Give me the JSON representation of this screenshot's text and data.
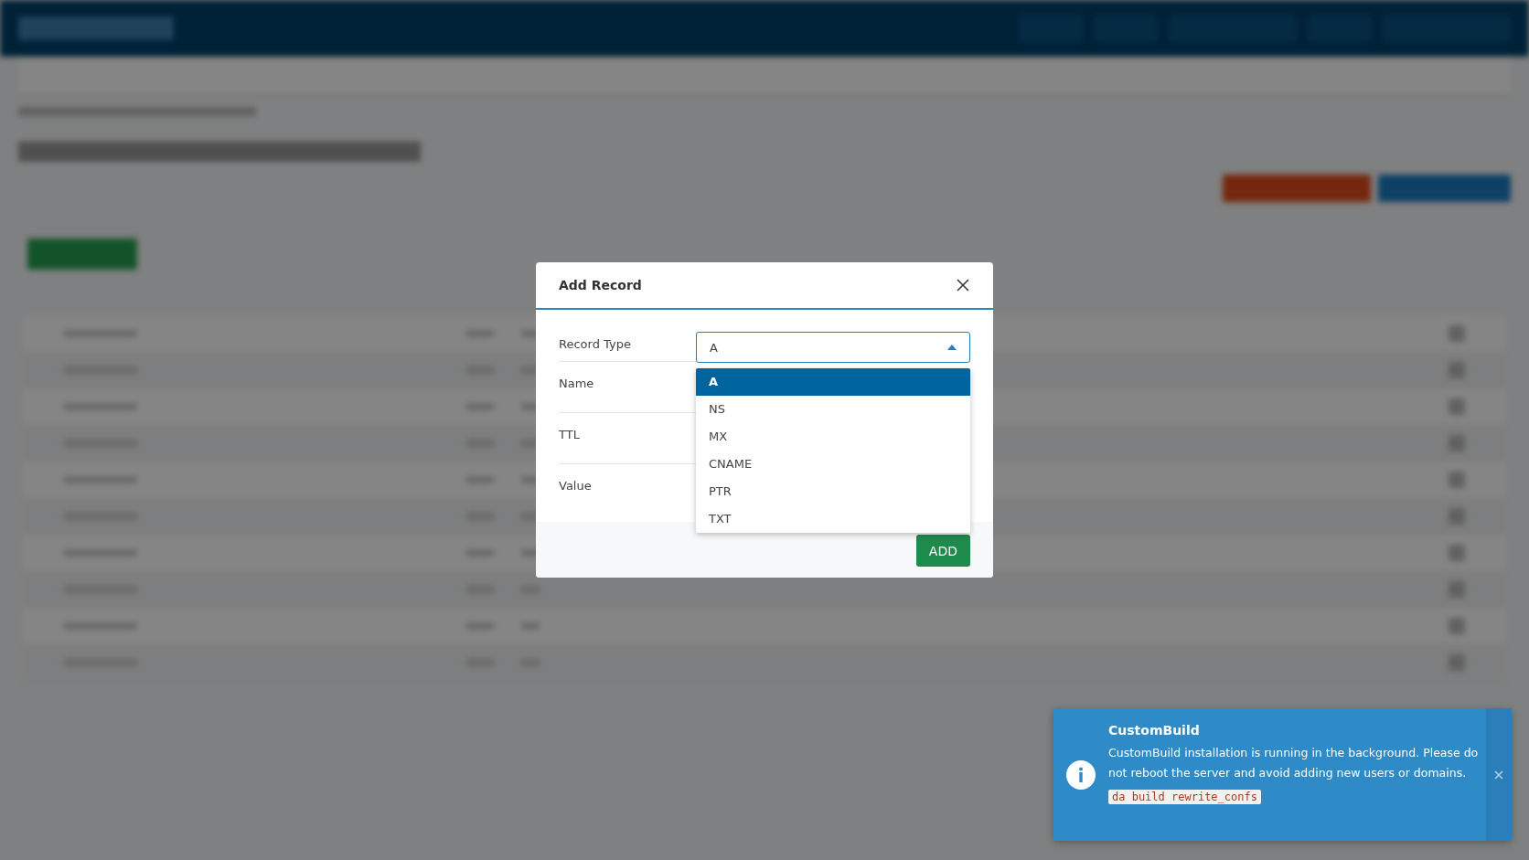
{
  "dialog": {
    "title": "Add Record",
    "fields": [
      {
        "label": "Record Type"
      },
      {
        "label": "Name"
      },
      {
        "label": "TTL"
      },
      {
        "label": "Value"
      }
    ],
    "record_type_select": {
      "value": "A",
      "expanded": true,
      "options": [
        {
          "label": "A",
          "selected": true
        },
        {
          "label": "NS",
          "selected": false
        },
        {
          "label": "MX",
          "selected": false
        },
        {
          "label": "CNAME",
          "selected": false
        },
        {
          "label": "PTR",
          "selected": false
        },
        {
          "label": "TXT",
          "selected": false
        }
      ]
    },
    "add_button": "ADD"
  },
  "notification": {
    "title": "CustomBuild",
    "message": "CustomBuild installation is running in the background. Please do not reboot the server and avoid adding new users or domains.",
    "code": "da build rewrite_confs"
  }
}
